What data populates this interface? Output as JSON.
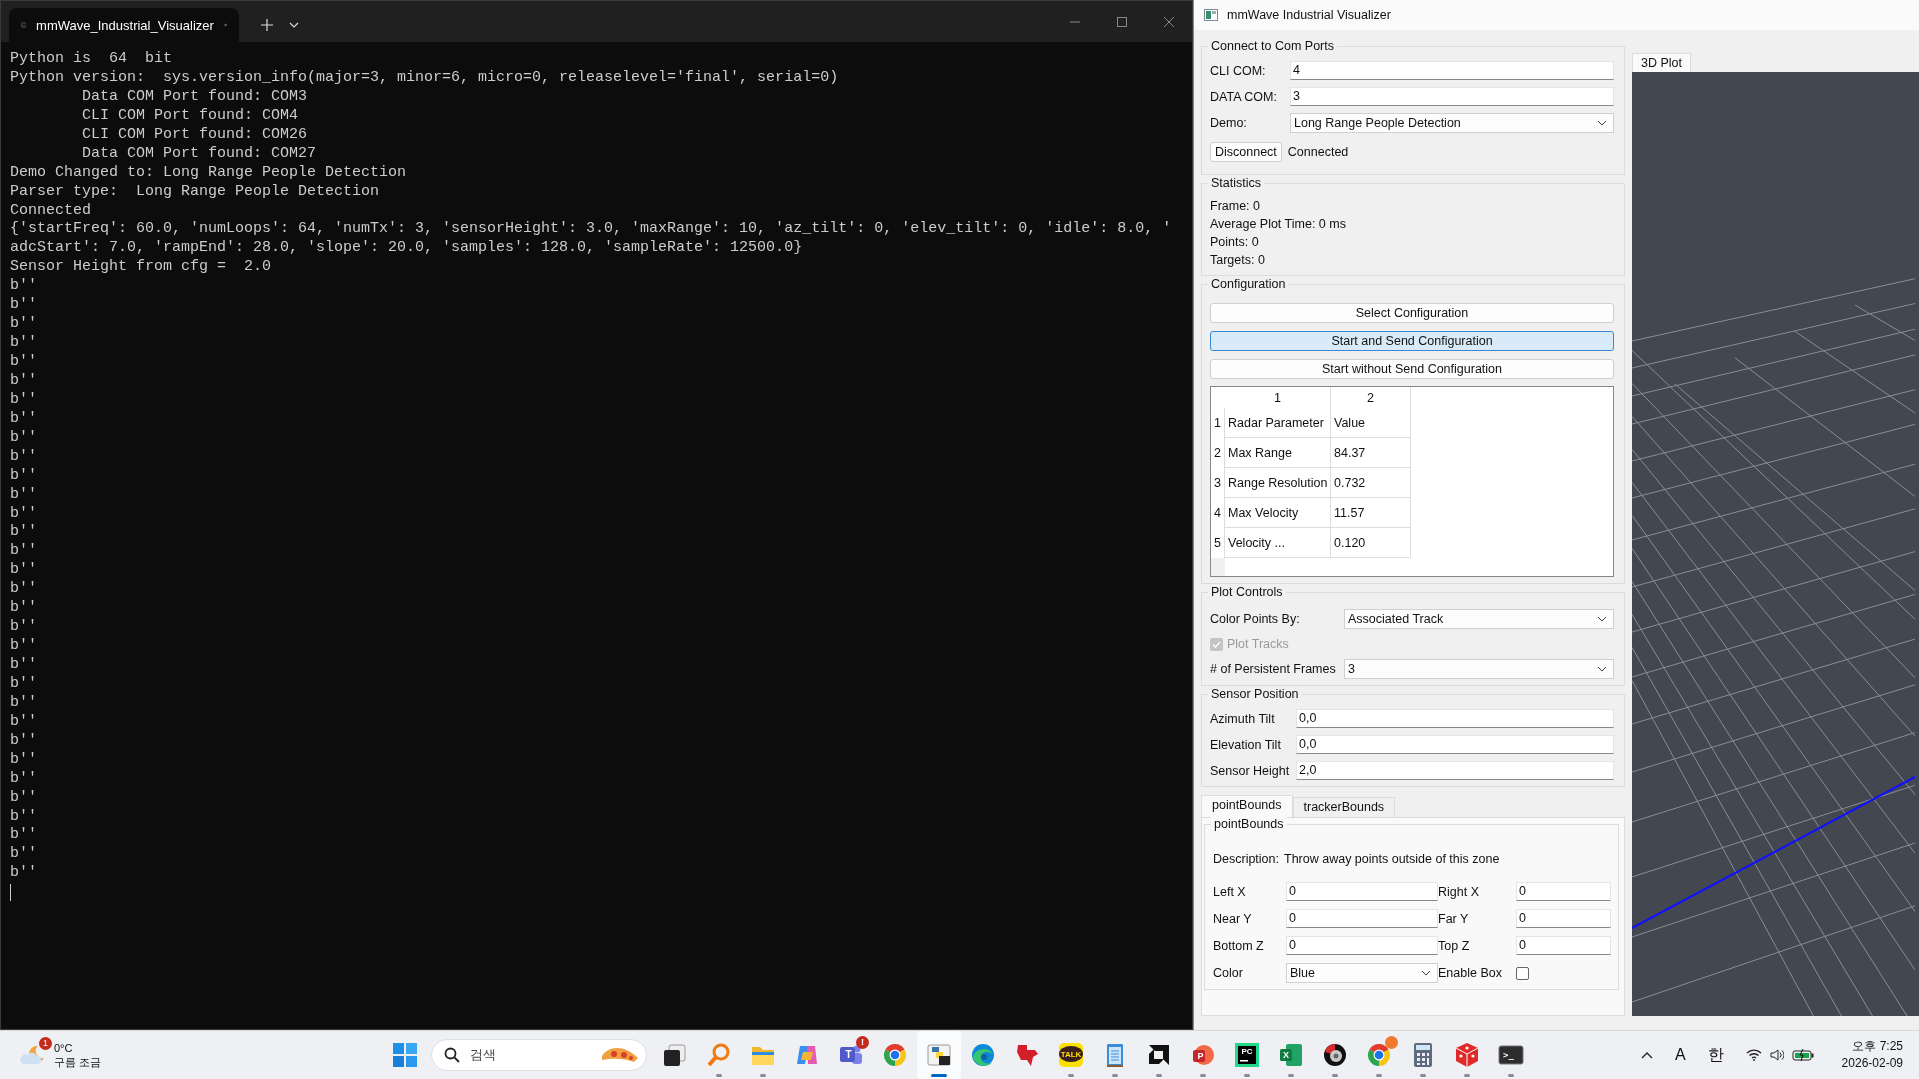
{
  "terminal": {
    "tab_title": "mmWave_Industrial_Visualizer",
    "lines": [
      "Python is  64  bit",
      "Python version:  sys.version_info(major=3, minor=6, micro=0, releaselevel='final', serial=0)",
      "        Data COM Port found: COM3",
      "        CLI COM Port found: COM4",
      "        CLI COM Port found: COM26",
      "        Data COM Port found: COM27",
      "Demo Changed to: Long Range People Detection",
      "Parser type:  Long Range People Detection",
      "Connected",
      "{'startFreq': 60.0, 'numLoops': 64, 'numTx': 3, 'sensorHeight': 3.0, 'maxRange': 10, 'az_tilt': 0, 'elev_tilt': 0, 'idle': 8.0, '",
      "adcStart': 7.0, 'rampEnd': 28.0, 'slope': 20.0, 'samples': 128.0, 'sampleRate': 12500.0}",
      "Sensor Height from cfg =  2.0",
      "b''",
      "b''",
      "b''",
      "b''",
      "b''",
      "b''",
      "b''",
      "b''",
      "b''",
      "b''",
      "b''",
      "b''",
      "b''",
      "b''",
      "b''",
      "b''",
      "b''",
      "b''",
      "b''",
      "b''",
      "b''",
      "b''",
      "b''",
      "b''",
      "b''",
      "b''",
      "b''",
      "b''",
      "b''",
      "b''",
      "b''",
      "b''"
    ]
  },
  "visualizer": {
    "title": "mmWave Industrial Visualizer",
    "connect": {
      "title": "Connect to Com Ports",
      "fields": [
        {
          "kind": "text",
          "label": "CLI COM:",
          "value": "4"
        },
        {
          "kind": "text",
          "label": "DATA COM:",
          "value": "3"
        },
        {
          "kind": "select",
          "label": "Demo:",
          "value": "Long Range People Detection"
        }
      ],
      "button": "Disconnect",
      "status": "Connected"
    },
    "statistics": {
      "title": "Statistics",
      "lines": [
        "Frame: 0",
        "Average Plot Time: 0 ms",
        "Points: 0",
        "Targets: 0"
      ]
    },
    "configuration": {
      "title": "Configuration",
      "buttons": [
        {
          "label": "Select Configuration",
          "focused": false
        },
        {
          "label": "Start and Send Configuration",
          "focused": true
        },
        {
          "label": "Start without Send Configuration",
          "focused": false
        }
      ],
      "table": {
        "columns": [
          "1",
          "2"
        ],
        "rows": [
          {
            "header": "1",
            "cells": [
              "Radar Parameter",
              "Value"
            ]
          },
          {
            "header": "2",
            "cells": [
              "Max Range",
              "84.37"
            ]
          },
          {
            "header": "3",
            "cells": [
              "Range Resolution",
              "0.732"
            ]
          },
          {
            "header": "4",
            "cells": [
              "Max Velocity",
              "11.57"
            ]
          },
          {
            "header": "5",
            "cells": [
              "Velocity ...",
              "0.120"
            ]
          }
        ]
      }
    },
    "plot_controls": {
      "title": "Plot Controls",
      "controls": [
        {
          "kind": "select",
          "label": "Color Points By:",
          "value": "Associated Track",
          "disabled": false
        },
        {
          "kind": "checkbox",
          "label": "Plot Tracks",
          "checked": true,
          "disabled": true
        },
        {
          "kind": "select",
          "label": "# of Persistent Frames",
          "value": "3",
          "disabled": false
        }
      ]
    },
    "sensor_position": {
      "title": "Sensor Position",
      "fields": [
        {
          "label": "Azimuth Tilt",
          "value": "0,0"
        },
        {
          "label": "Elevation Tilt",
          "value": "0,0"
        },
        {
          "label": "Sensor Height",
          "value": "2,0"
        }
      ]
    },
    "bounds": {
      "tabs": [
        {
          "label": "pointBounds",
          "selected": true
        },
        {
          "label": "trackerBounds",
          "selected": false
        }
      ],
      "group_title": "pointBounds",
      "description_label": "Description:",
      "description": "Throw away points outside of this zone",
      "fields": [
        {
          "kind": "text",
          "label": "Left X",
          "value": "0"
        },
        {
          "kind": "text",
          "label": "Right X",
          "value": "0"
        },
        {
          "kind": "text",
          "label": "Near Y",
          "value": "0"
        },
        {
          "kind": "text",
          "label": "Far Y",
          "value": "0"
        },
        {
          "kind": "text",
          "label": "Bottom Z",
          "value": "0"
        },
        {
          "kind": "text",
          "label": "Top Z",
          "value": "0"
        },
        {
          "kind": "select",
          "label": "Color",
          "value": "Blue"
        },
        {
          "kind": "checkbox",
          "label": "Enable Box",
          "checked": false
        }
      ]
    },
    "plot_tabs": [
      {
        "label": "3D Plot",
        "selected": true
      }
    ]
  },
  "taskbar": {
    "weather": {
      "badge": "1",
      "temperature": "0°C",
      "condition": "구름 조금"
    },
    "search_placeholder": "검색",
    "apps": [
      {
        "kind": "taskview",
        "running": false,
        "active": false
      },
      {
        "kind": "magnifier",
        "running": true,
        "active": false
      },
      {
        "kind": "folder",
        "running": true,
        "active": false
      },
      {
        "kind": "copilot",
        "running": false,
        "active": false
      },
      {
        "kind": "teams",
        "running": false,
        "active": false,
        "glyph": "T",
        "badge": "!"
      },
      {
        "kind": "chrome",
        "running": false,
        "active": false
      },
      {
        "kind": "python",
        "running": true,
        "active": true
      },
      {
        "kind": "edge",
        "running": false,
        "active": false
      },
      {
        "kind": "ti",
        "running": false,
        "active": false
      },
      {
        "kind": "talk",
        "running": true,
        "active": false,
        "glyph": "TALK"
      },
      {
        "kind": "notepad",
        "running": true,
        "active": false
      },
      {
        "kind": "amd",
        "running": true,
        "active": false
      },
      {
        "kind": "pdf",
        "running": true,
        "active": false,
        "glyph": "P"
      },
      {
        "kind": "pycharm",
        "running": true,
        "active": false,
        "glyph": "PC"
      },
      {
        "kind": "excel",
        "running": true,
        "active": false,
        "glyph": "X"
      },
      {
        "kind": "disc",
        "running": true,
        "active": false
      },
      {
        "kind": "chrome",
        "running": true,
        "active": false,
        "notice": true
      },
      {
        "kind": "calculator",
        "running": true,
        "active": false
      },
      {
        "kind": "cube",
        "running": true,
        "active": false
      },
      {
        "kind": "terminal",
        "running": true,
        "active": false,
        "glyph": ">_"
      }
    ],
    "tray": {
      "ime_mode": "A",
      "ime_language": "한",
      "time": "오후 7:25",
      "date": "2026-02-09"
    }
  }
}
